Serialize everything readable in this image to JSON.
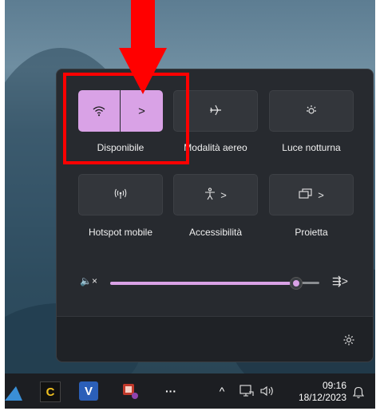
{
  "quick_settings": {
    "tiles": [
      {
        "label": "Disponibile",
        "icon": "wifi-icon",
        "active": true,
        "expand": ">"
      },
      {
        "label": "Modalità aereo",
        "icon": "airplane-icon",
        "active": false
      },
      {
        "label": "Luce notturna",
        "icon": "night-light-icon",
        "active": false
      },
      {
        "label": "Hotspot mobile",
        "icon": "hotspot-icon",
        "active": false
      },
      {
        "label": "Accessibilità",
        "icon": "accessibility-icon",
        "active": false,
        "expand": ">"
      },
      {
        "label": "Proietta",
        "icon": "project-icon",
        "active": false,
        "expand": ">"
      }
    ],
    "volume": {
      "level": 0.88,
      "muted": true,
      "mute_glyph": "🔈×",
      "audio_output_glyph": "⇶>"
    },
    "settings_icon": "gear-icon"
  },
  "taskbar": {
    "apps": [
      {
        "icon": "ccleaner-icon",
        "glyph": "C"
      },
      {
        "icon": "visio-icon",
        "glyph": "V"
      },
      {
        "icon": "snipping-tool-icon",
        "glyph": "✂"
      },
      {
        "icon": "more-icon",
        "glyph": "···"
      }
    ],
    "tray": {
      "chevron": "^",
      "time": "09:16",
      "date": "18/12/2023"
    }
  },
  "colors": {
    "accent": "#d9a2e6",
    "panel_bg": "#272a2f",
    "annotation": "#ff0000"
  }
}
